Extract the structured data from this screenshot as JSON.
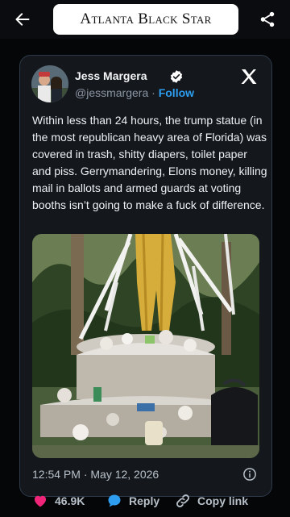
{
  "app": {
    "brand": "Atlanta Black Star"
  },
  "topbar": {
    "back_icon": "arrow-left-icon",
    "share_icon": "share-icon"
  },
  "tweet": {
    "author_name": "Jess Margera",
    "handle": "@jessmargera",
    "separator": "·",
    "follow_label": "Follow",
    "text": "Within less than 24 hours, the trump statue (in the most republican heavy area of Florida) was covered in trash, shitty diapers, toilet paper and piss. Gerrymandering, Elons money, killing mail in ballots and armed guards at voting booths isn’t going to make a fuck of difference.",
    "timestamp": "12:54 PM · May 12, 2026",
    "verified_icon": "verified-badge-icon",
    "platform_icon": "x-logo-icon",
    "info_icon": "info-icon"
  },
  "actions": {
    "likes": "46.9K",
    "reply_label": "Reply",
    "copy_label": "Copy link"
  },
  "colors": {
    "background": "#050608",
    "card": "#14171c",
    "card_border": "#2e3a49",
    "accent": "#2d9ef0",
    "like": "#f0257a"
  }
}
